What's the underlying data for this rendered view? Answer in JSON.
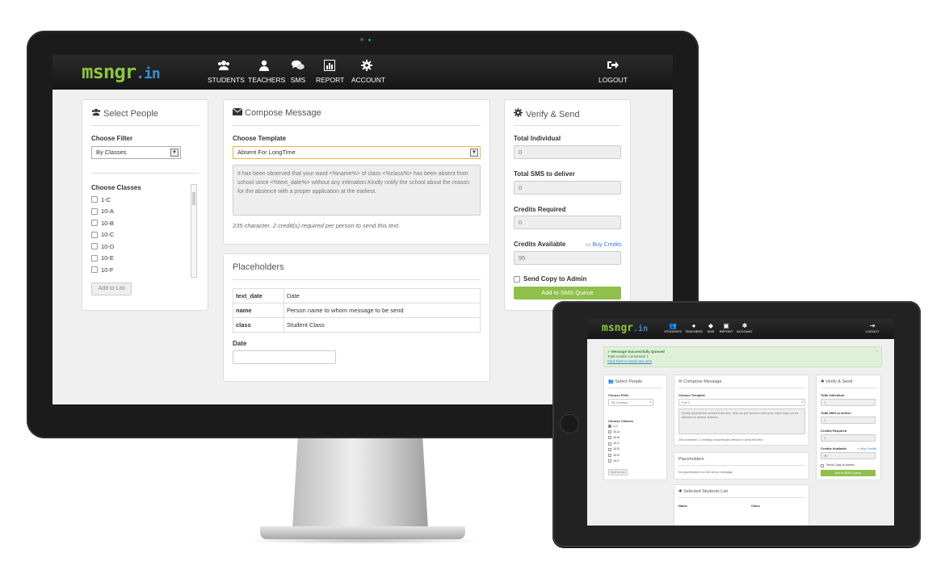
{
  "brand": {
    "name": "msngr",
    "tld": ".in",
    "accent": "#8cc63f",
    "tld_color": "#3d8fd6"
  },
  "navbar": {
    "items": [
      {
        "label": "STUDENTS",
        "icon": "users-icon"
      },
      {
        "label": "TEACHERS",
        "icon": "user-icon"
      },
      {
        "label": "SMS",
        "icon": "chat-bubbles-icon"
      },
      {
        "label": "REPORT",
        "icon": "bar-chart-icon"
      },
      {
        "label": "ACCOUNT",
        "icon": "gear-icon"
      }
    ],
    "logout_label": "LOGOUT"
  },
  "select_people": {
    "title": "Select People",
    "filter_label": "Choose Filter",
    "filter_value": "By Classes",
    "classes_label": "Choose Classes",
    "classes": [
      "1-C",
      "10-A",
      "10-B",
      "10-C",
      "10-D",
      "10-E",
      "10-F"
    ],
    "add_button": "Add to List"
  },
  "compose": {
    "title": "Compose Message",
    "template_label": "Choose Template",
    "template_value": "Absent For LongTime",
    "message": "It has been observed that your ward <%name%> of class <%class%> has been absent from school since <%text_date%> without any intimation.Kindly notify the school about the reason for the absence with a proper application at the earliest.",
    "char_note": "235 character. 2 credit(s) required per person to send this text."
  },
  "placeholders": {
    "title": "Placeholders",
    "rows": [
      {
        "key": "text_date",
        "desc": "Date"
      },
      {
        "key": "name",
        "desc": "Person name to whom message to be send"
      },
      {
        "key": "class",
        "desc": "Student Class"
      }
    ],
    "date_label": "Date",
    "date_value": ""
  },
  "verify": {
    "title": "Verify & Send",
    "total_individual_label": "Total Individual",
    "total_individual": "0",
    "total_sms_label": "Total SMS to deliver",
    "total_sms": "0",
    "credits_required_label": "Credits Required",
    "credits_required": "0",
    "credits_available_label": "Credits Available",
    "credits_available": "95",
    "buy_credits": "Buy Credits",
    "copy_admin_label": "Send Copy to Admin",
    "queue_button": "Add to SMS Queue"
  },
  "tablet": {
    "alert_title": "Message Successfully Queued",
    "alert_line": "Total credits consumed: 1",
    "alert_link": "Click here to send new sms",
    "close": "×",
    "template_value": "Fee 2",
    "message": "Kindly deposit the school fees due, else as per school rules your ward may not be allowed to attend classes.",
    "char_note": "106 character. 1 credit(s) required per person to send this text.",
    "no_placeholders": "No placeholders for the above message",
    "selected_title": "Selected Students List",
    "col_name": "Name",
    "col_class": "Class",
    "classes": [
      "1-C",
      "10-A",
      "10-B",
      "10-C",
      "10-D",
      "10-E",
      "10-F"
    ],
    "verify_values": [
      "1",
      "1",
      "1",
      "95"
    ]
  }
}
